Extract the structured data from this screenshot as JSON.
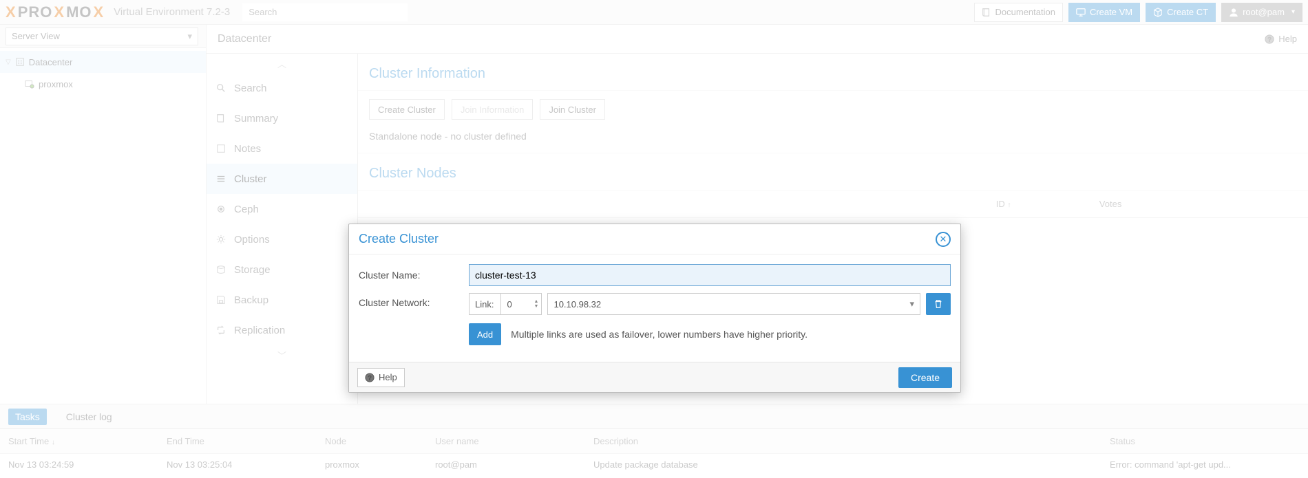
{
  "header": {
    "product": "Virtual Environment 7.2-3",
    "search_placeholder": "Search",
    "documentation": "Documentation",
    "create_vm": "Create VM",
    "create_ct": "Create CT",
    "user": "root@pam"
  },
  "server_view_label": "Server View",
  "tree": {
    "datacenter": "Datacenter",
    "node": "proxmox"
  },
  "crumb": "Datacenter",
  "help_label": "Help",
  "sidemenu": {
    "search": "Search",
    "summary": "Summary",
    "notes": "Notes",
    "cluster": "Cluster",
    "ceph": "Ceph",
    "options": "Options",
    "storage": "Storage",
    "backup": "Backup",
    "replication": "Replication"
  },
  "cluster_panel": {
    "info_title": "Cluster Information",
    "create_cluster": "Create Cluster",
    "join_information": "Join Information",
    "join_cluster": "Join Cluster",
    "standalone_text": "Standalone node - no cluster defined",
    "nodes_title": "Cluster Nodes",
    "col_id": "ID",
    "col_votes": "Votes"
  },
  "modal": {
    "title": "Create Cluster",
    "name_label": "Cluster Name:",
    "name_value": "cluster-test-13",
    "network_label": "Cluster Network:",
    "link_label": "Link:",
    "link_number": "0",
    "ip_value": "10.10.98.32",
    "add": "Add",
    "failover_hint": "Multiple links are used as failover, lower numbers have higher priority.",
    "help": "Help",
    "create": "Create"
  },
  "log": {
    "tasks": "Tasks",
    "cluster_log": "Cluster log",
    "cols": {
      "start": "Start Time",
      "end": "End Time",
      "node": "Node",
      "user": "User name",
      "desc": "Description",
      "status": "Status"
    },
    "row": {
      "start": "Nov 13 03:24:59",
      "end": "Nov 13 03:25:04",
      "node": "proxmox",
      "user": "root@pam",
      "desc": "Update package database",
      "status": "Error: command 'apt-get upd..."
    }
  }
}
